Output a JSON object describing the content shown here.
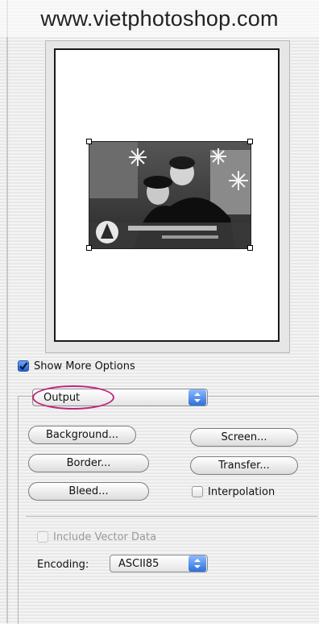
{
  "watermark": "www.vietphotoshop.com",
  "show_more_options": {
    "label": "Show More Options",
    "checked": true
  },
  "output_popup": {
    "value": "Output"
  },
  "buttons": {
    "background": "Background...",
    "screen": "Screen...",
    "border": "Border...",
    "transfer": "Transfer...",
    "bleed": "Bleed..."
  },
  "interpolation": {
    "label": "Interpolation",
    "checked": false
  },
  "include_vector_data": {
    "label": "Include Vector Data",
    "checked": false,
    "enabled": false
  },
  "encoding": {
    "label": "Encoding:",
    "value": "ASCII85"
  },
  "colors": {
    "accent": "#2f6fdd",
    "highlight": "#c0267a"
  }
}
